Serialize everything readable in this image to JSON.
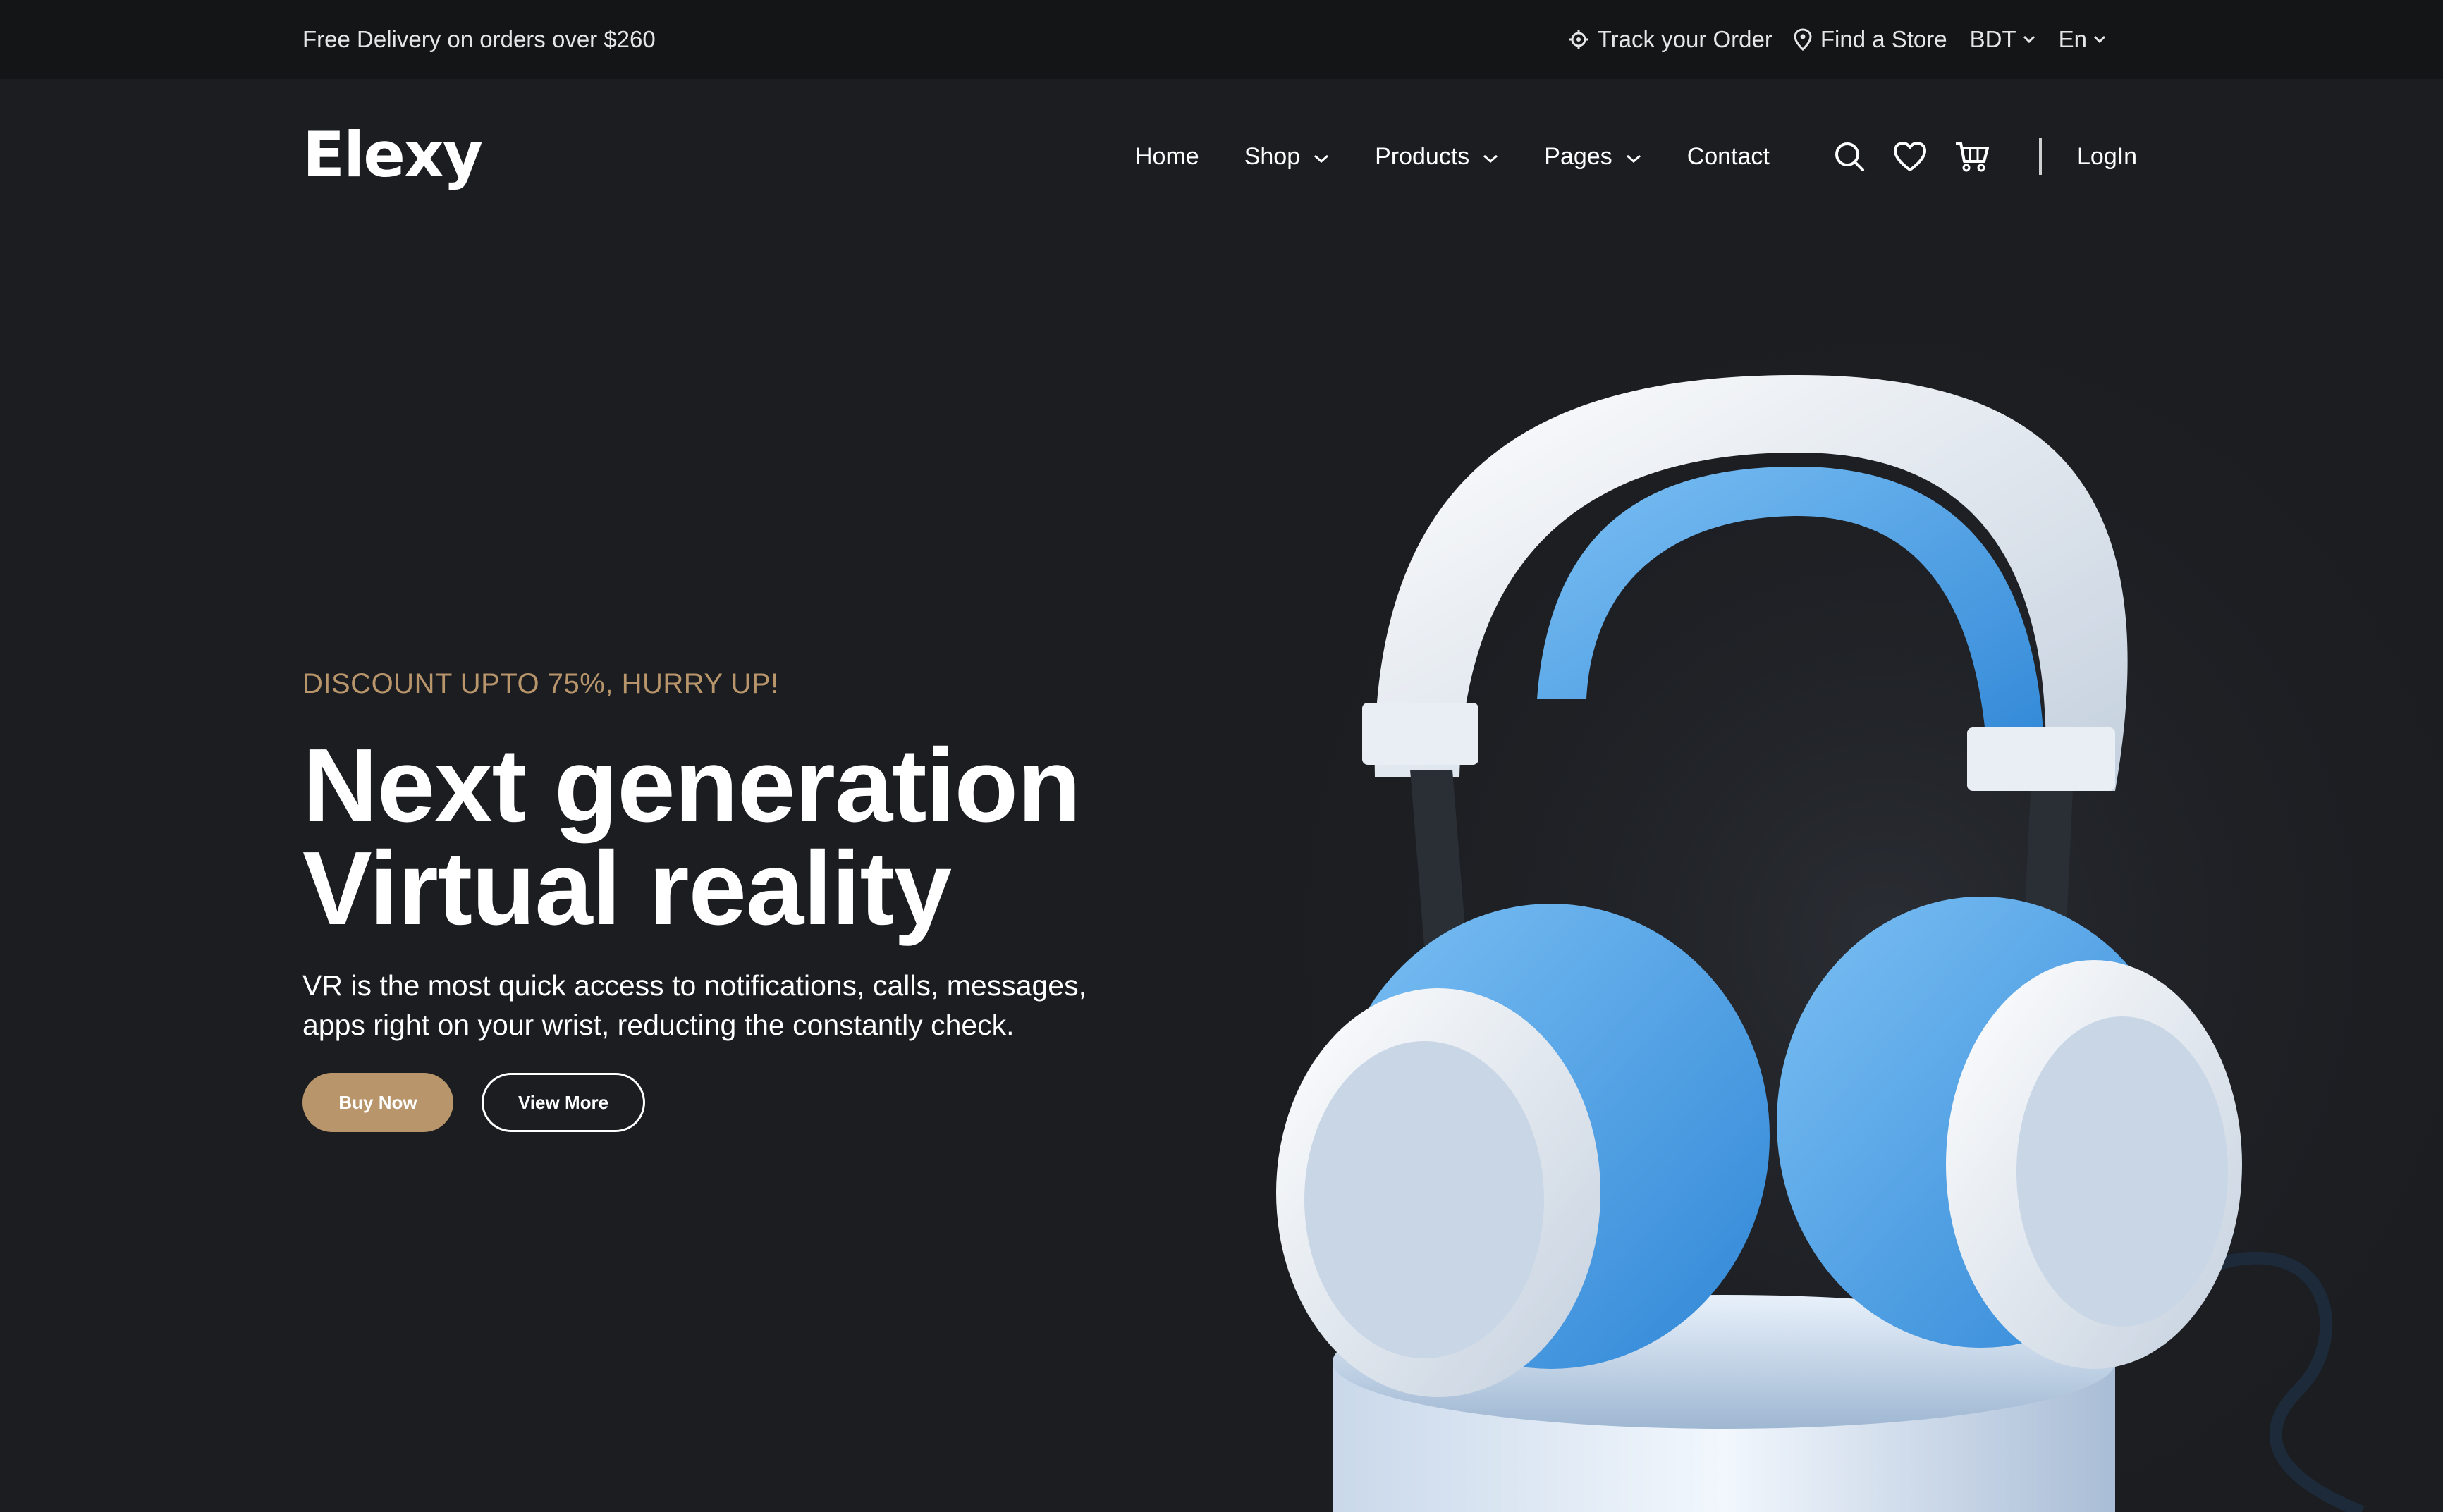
{
  "topbar": {
    "promo": "Free Delivery on orders over $260",
    "track_order": "Track your Order",
    "find_store": "Find a Store",
    "currency": "BDT",
    "language": "En"
  },
  "header": {
    "logo": "Elexy",
    "nav": [
      {
        "label": "Home",
        "dropdown": false
      },
      {
        "label": "Shop",
        "dropdown": true
      },
      {
        "label": "Products",
        "dropdown": true
      },
      {
        "label": "Pages",
        "dropdown": true
      },
      {
        "label": "Contact",
        "dropdown": false
      }
    ],
    "icons": [
      "search-icon",
      "heart-icon",
      "cart-icon"
    ],
    "login": "LogIn"
  },
  "hero": {
    "discount": "DISCOUNT UPTO 75%, HURRY UP!",
    "headline_line1": "Next generation",
    "headline_line2": "Virtual reality",
    "description": "VR is the most quick access to notifications, calls, messages, apps right on your wrist, reducting the constantly check.",
    "buy_button": "Buy Now",
    "more_button": "View More"
  },
  "colors": {
    "background": "#1b1d21",
    "topbar": "#141517",
    "accent": "#b8956a",
    "headphone_blue": "#4aa3e6"
  }
}
